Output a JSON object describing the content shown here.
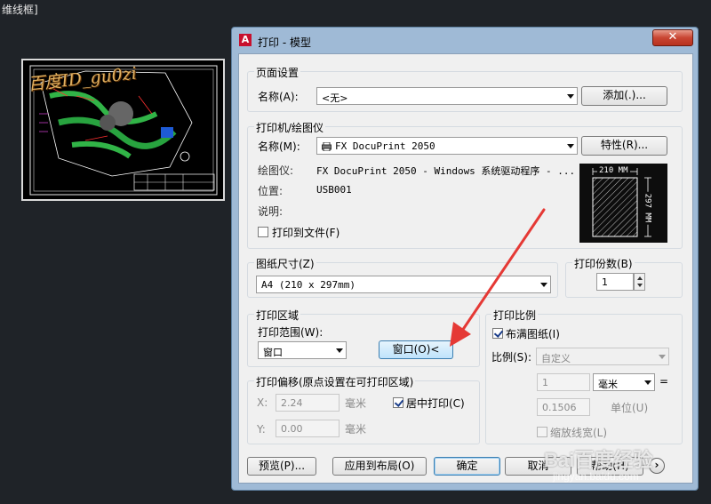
{
  "background": {
    "command_text": "维线框]",
    "watermark_top": "百度ID_gu0zi",
    "watermark_bottom": "Bai百度经验",
    "watermark_url": "jingyan.baidu.com"
  },
  "dialog": {
    "app_icon_letter": "A",
    "title": "打印 - 模型",
    "close_label": "✕",
    "page_setup": {
      "group_title": "页面设置",
      "name_label": "名称(A):",
      "name_value": "<无>",
      "add_button": "添加(.)..."
    },
    "printer": {
      "group_title": "打印机/绘图仪",
      "name_label": "名称(M):",
      "name_value": "FX DocuPrint 2050",
      "properties_button": "特性(R)...",
      "plotter_label": "绘图仪:",
      "plotter_value": "FX DocuPrint 2050 - Windows 系统驱动程序 - ...",
      "location_label": "位置:",
      "location_value": "USB001",
      "description_label": "说明:",
      "print_to_file_label": "打印到文件(F)",
      "print_to_file_checked": false,
      "preview_width": "210 MM",
      "preview_height": "297 MM"
    },
    "paper_size": {
      "group_title": "图纸尺寸(Z)",
      "value": "A4 (210 x 297mm)"
    },
    "copies": {
      "group_title": "打印份数(B)",
      "value": "1"
    },
    "plot_area": {
      "group_title": "打印区域",
      "range_label": "打印范围(W):",
      "range_value": "窗口",
      "window_button": "窗口(O)<"
    },
    "plot_offset": {
      "group_title": "打印偏移(原点设置在可打印区域)",
      "x_label": "X:",
      "x_value": "2.24",
      "x_unit": "毫米",
      "y_label": "Y:",
      "y_value": "0.00",
      "y_unit": "毫米",
      "center_label": "居中打印(C)",
      "center_checked": true
    },
    "plot_scale": {
      "group_title": "打印比例",
      "fit_label": "布满图纸(I)",
      "fit_checked": true,
      "scale_label": "比例(S):",
      "scale_value": "自定义",
      "value1": "1",
      "unit_value": "毫米",
      "equals": "=",
      "value2": "0.1506",
      "unit_label": "单位(U)",
      "lineweight_label": "缩放线宽(L)",
      "lineweight_checked": false
    },
    "footer": {
      "preview_button": "预览(P)...",
      "apply_button": "应用到布局(O)",
      "ok_button": "确定",
      "cancel_button": "取消",
      "help_button": "帮助(H)",
      "expand_icon_glyph": "›"
    }
  },
  "colors": {
    "desktop_bg": "#1f2328",
    "frame": "#9fbad6",
    "arrow": "#e53935",
    "close": "#c94532"
  }
}
